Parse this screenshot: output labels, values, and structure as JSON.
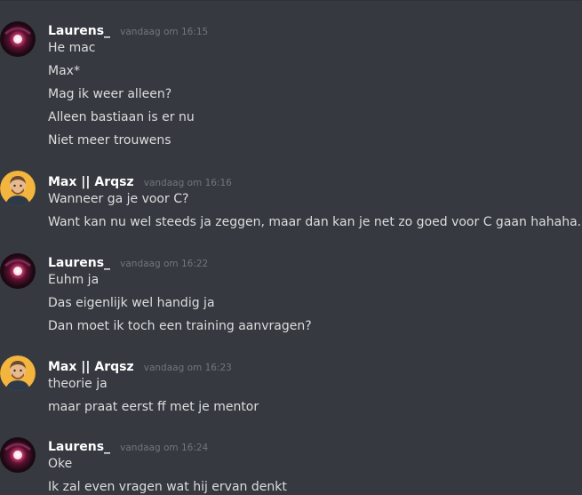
{
  "messages": [
    {
      "author": "Laurens_",
      "time": "vandaag om 16:15",
      "avatar": "laurens-avatar",
      "lines": [
        "He mac",
        "Max*",
        "Mag ik weer alleen?",
        "Alleen bastiaan is er nu",
        "Niet meer trouwens"
      ]
    },
    {
      "author": "Max || Arqsz",
      "time": "vandaag om 16:16",
      "avatar": "max-avatar",
      "lines": [
        "Wanneer ga je  voor C?",
        "Want kan nu wel steeds ja zeggen, maar dan kan je net zo goed voor C gaan hahaha."
      ]
    },
    {
      "author": "Laurens_",
      "time": "vandaag om 16:22",
      "avatar": "laurens-avatar",
      "lines": [
        "Euhm ja",
        "Das eigenlijk wel handig ja",
        "Dan moet ik toch een training aanvragen?"
      ]
    },
    {
      "author": "Max || Arqsz",
      "time": "vandaag om 16:23",
      "avatar": "max-avatar",
      "lines": [
        "theorie ja",
        "maar praat eerst ff met je mentor"
      ]
    },
    {
      "author": "Laurens_",
      "time": "vandaag om 16:24",
      "avatar": "laurens-avatar",
      "lines": [
        "Oke",
        "Ik zal even vragen wat hij ervan denkt"
      ]
    }
  ],
  "colors": {
    "background": "#36393f",
    "username": "#ffffff",
    "timestamp": "#72767d",
    "text": "#dcddde"
  }
}
